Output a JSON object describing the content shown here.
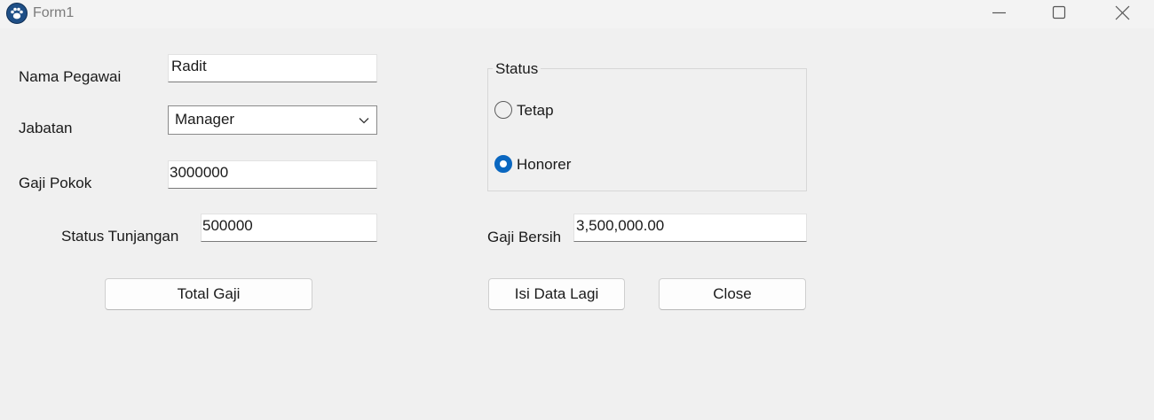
{
  "window": {
    "title": "Form1"
  },
  "form": {
    "nama_pegawai": {
      "label": "Nama Pegawai",
      "value": "Radit"
    },
    "jabatan": {
      "label": "Jabatan",
      "selected": "Manager"
    },
    "gaji_pokok": {
      "label": "Gaji Pokok",
      "value": "3000000"
    },
    "status_tunjangan": {
      "label": "Status Tunjangan",
      "value": "500000"
    },
    "gaji_bersih": {
      "label": "Gaji Bersih",
      "value": "3,500,000.00"
    }
  },
  "status_group": {
    "title": "Status",
    "options": [
      {
        "label": "Tetap",
        "checked": false
      },
      {
        "label": "Honorer",
        "checked": true
      }
    ]
  },
  "buttons": {
    "total_gaji": "Total Gaji",
    "isi_data_lagi": "Isi Data Lagi",
    "close": "Close"
  },
  "colors": {
    "accent": "#0a67c0",
    "background": "#f0f0f0"
  },
  "icons": {
    "app": "paw-icon",
    "minimize": "minimize-icon",
    "maximize": "maximize-icon",
    "close": "close-icon",
    "dropdown": "chevron-down-icon"
  }
}
